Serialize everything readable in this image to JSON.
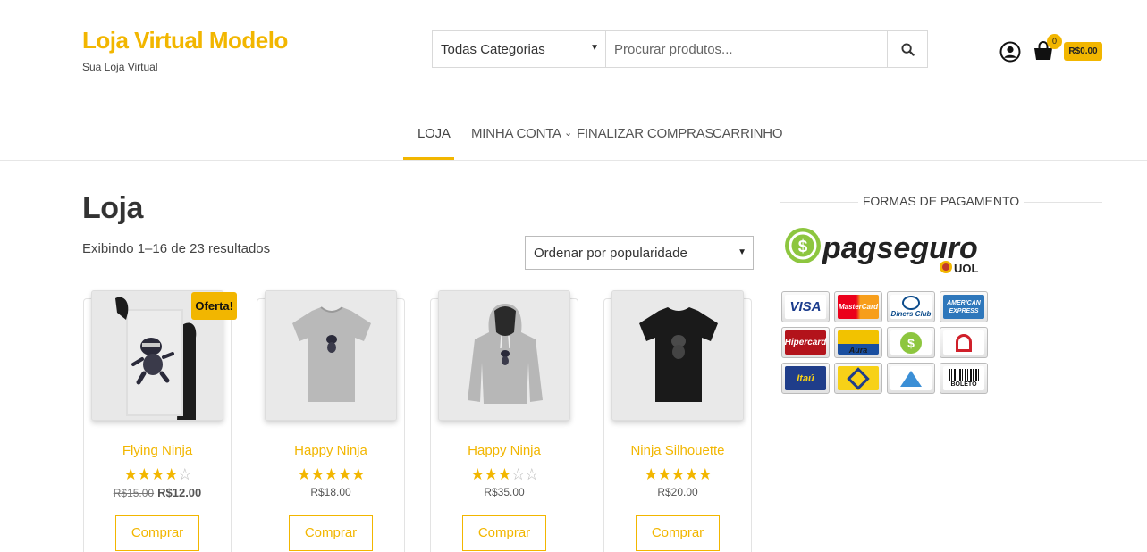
{
  "header": {
    "site_title": "Loja Virtual Modelo",
    "tagline": "Sua Loja Virtual",
    "search": {
      "category_selected": "Todas Categorias",
      "placeholder": "Procurar produtos..."
    },
    "cart": {
      "count": "0",
      "total": "R$0.00"
    }
  },
  "nav": {
    "items": [
      {
        "label": "Loja",
        "active": true
      },
      {
        "label": "Minha Conta",
        "has_submenu": true
      },
      {
        "label": "Finalizar Compras"
      },
      {
        "label": "Carrinho"
      }
    ]
  },
  "main": {
    "title": "Loja",
    "result_count": "Exibindo 1–16 de 23 resultados",
    "orderby_selected": "Ordenar por popularidade",
    "buy_label": "Comprar",
    "products": [
      {
        "name": "Flying Ninja",
        "rating": 4,
        "old_price": "R$15.00",
        "price": "R$12.00",
        "sale_badge": "Oferta!"
      },
      {
        "name": "Happy Ninja",
        "rating": 5,
        "price": "R$18.00"
      },
      {
        "name": "Happy Ninja",
        "rating": 3,
        "price": "R$35.00"
      },
      {
        "name": "Ninja Silhouette",
        "rating": 5,
        "price": "R$20.00"
      }
    ]
  },
  "sidebar": {
    "widget_title": "FORMAS DE PAGAMENTO",
    "pagseguro_logo_text": "pagseguro",
    "pagseguro_uol": "UOL",
    "payment_methods": [
      "VISA",
      "MasterCard",
      "Diners Club",
      "AMERICAN EXPRESS",
      "Hipercard",
      "Aura",
      "PagSeguro",
      "Banrisul",
      "Itaú",
      "Banco do Brasil",
      "Bradesco",
      "BOLETO"
    ]
  },
  "colors": {
    "accent": "#f2b600"
  }
}
